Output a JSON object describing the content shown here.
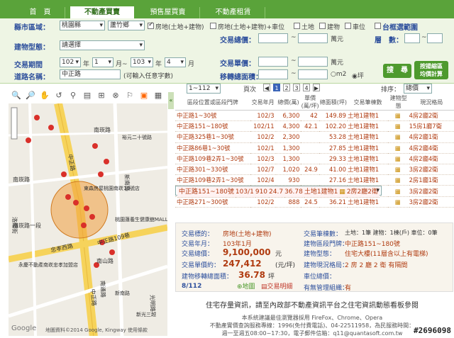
{
  "tabs": [
    "首　頁",
    "不動產買賣",
    "預售屋買賣",
    "不動產租賃"
  ],
  "form": {
    "county_label": "縣市區域：",
    "county_value": "桃園縣",
    "district_value": "蘆竹鄉",
    "type_options": [
      "房地(土地+建物)",
      "房地(土地+建物)+車位",
      "土地",
      "建物",
      "車位"
    ],
    "map_range_label": "台框選範圍",
    "total_price_label": "交易總價：",
    "wan_label": "萬元",
    "floor_label": "層　數：",
    "build_type_label": "建物型態：",
    "build_type_value": "請選擇",
    "period_label": "交易期間",
    "year1": "102",
    "month1": "1",
    "year2": "103",
    "month2": "4",
    "year_unit": "年",
    "month_unit": "月",
    "to_unit": "月~",
    "unit_price_label": "交易單價：",
    "wan_label2": "萬元",
    "road_label": "道路名稱：",
    "road_value": "中正路",
    "road_hint": "(可輸入任意字數)",
    "area_label": "移轉總面積：",
    "area_unit_m2": "m2",
    "area_unit_ping": "坪",
    "search_button": "搜　尋",
    "calc_button_1": "按揚縮區",
    "calc_button_2": "均價計算"
  },
  "map": {
    "streets": [
      "中正路",
      "中正路",
      "新南路",
      "南崁路",
      "洛陽街",
      "忠孝西路",
      "中正路109巷",
      "南崁路",
      "南山路",
      "南崁路一段",
      "南通路",
      "光明路",
      "永慶不動產南崁忠孝加盟店",
      "東森房屋桃園南崁10號店",
      "桃園蓮養生健康舘MALL you can eat",
      "裕元二十號路",
      "新南路",
      "新光三越"
    ],
    "copyright": "地圖資料©2014 Google, Kingway  使用條款",
    "google": "Google"
  },
  "results": {
    "page_select": "1~112",
    "page_prefix": "頁次",
    "pages": [
      "1",
      "2",
      "3",
      "4"
    ],
    "sort_label": "排序：",
    "sort_value": "總價",
    "headers": {
      "addr": "區段位置或區段門牌",
      "date": "交易年月",
      "total": "總價(萬)",
      "unit": "單價(萬/坪)",
      "area": "總面積(坪)",
      "items": "交易筆棟數",
      "type": "建物型態",
      "layout": "現況格局"
    },
    "rows": [
      {
        "addr": "中正路1~30號",
        "date": "102/3",
        "total": "6,300",
        "unit": "42",
        "area": "149.89",
        "items": "土地1建物1",
        "layout": "4房2廳2衛"
      },
      {
        "addr": "中正路151~180號",
        "date": "102/11",
        "total": "4,300",
        "unit": "42.1",
        "area": "102.20",
        "items": "土地1建物1",
        "layout": "15房1廳7衛"
      },
      {
        "addr": "中正路325巷1~30號",
        "date": "102/2",
        "total": "2,300",
        "unit": "",
        "area": "53.28",
        "items": "土地1建物1",
        "layout": "4房2廳1衛"
      },
      {
        "addr": "中正路86巷1~30號",
        "date": "102/1",
        "total": "1,300",
        "unit": "",
        "area": "27.85",
        "items": "土地1建物1",
        "layout": "4房2廳4衛"
      },
      {
        "addr": "中正路109巷2弄1~30號",
        "date": "102/3",
        "total": "1,300",
        "unit": "",
        "area": "29.33",
        "items": "土地1建物1",
        "layout": "4房2廳4衛"
      },
      {
        "addr": "中正路301~330號",
        "date": "102/7",
        "total": "1,020",
        "unit": "24.9",
        "area": "41.00",
        "items": "土地1建物1",
        "layout": "3房2廳2衛"
      },
      {
        "addr": "中正路109巷2弄1~30號",
        "date": "102/4",
        "total": "930",
        "unit": "",
        "area": "27.16",
        "items": "土地1建物1",
        "layout": "2房1廳1衛"
      },
      {
        "addr": "中正路151~180號",
        "date": "103/1",
        "total": "910",
        "unit": "24.7",
        "area": "36.78",
        "items": "土地1建物1",
        "layout": "2房2廳2衛"
      },
      {
        "addr": "中正路271~300號",
        "date": "102/10",
        "total": "895",
        "unit": "23.5",
        "area": "38.09",
        "items": "土地1建物1",
        "layout": "3房2廳2衛"
      },
      {
        "addr": "中正路271~300號",
        "date": "102/2",
        "total": "888",
        "area": "36.21",
        "unit": "24.5",
        "items": "土地1建物1",
        "layout": "3房2廳2衛"
      }
    ]
  },
  "detail": {
    "addr_label": "交易標的：",
    "addr_value": "房地(土地+建物)",
    "date_label": "交易年月：",
    "date_value": "103年1月",
    "total_label": "交易總價：",
    "total_value": "9,100,000",
    "total_unit": "元",
    "unit_label": "交易單價約：",
    "unit_value": "247,412",
    "unit_unit": "(元/坪)",
    "area_label": "建物移轉總面積：",
    "area_value": "36.78",
    "area_unit": "坪",
    "items_label": "交易筆棟數：",
    "items_value": "土地：1筆 建物：1棟(戶) 車位：0筆",
    "road_label": "建物區段門牌：",
    "road_value": "中正路151~180號",
    "type_label": "建物型態：",
    "type_value": "住宅大樓(11層含以上有電梯)",
    "layout_label": "建物現況格局：",
    "layout_value": "2 房 2 廳 2 衛 有隔間",
    "parking_label": "車位總價：",
    "manage_label": "有無管理組織：",
    "manage_value": "有",
    "index": "8/112",
    "map_button": "地圖",
    "detail_button": "交易明細"
  },
  "footer": {
    "banner": "住宅存量資訊，請至內政部不動產資訊平台之住宅資訊動態看板參閱",
    "line1": "本系統建議最佳瀏覽器採用 FireFox、Chrome、Opera",
    "line2": "不動產實價查詢服務專線：1996(免付費電話)、04-22511958，為民服務時間：",
    "line3": "週一至週五08:00~17:30，電子郵件信箱：q11@quantasoft.com.tw",
    "watermark": "#2696098"
  }
}
